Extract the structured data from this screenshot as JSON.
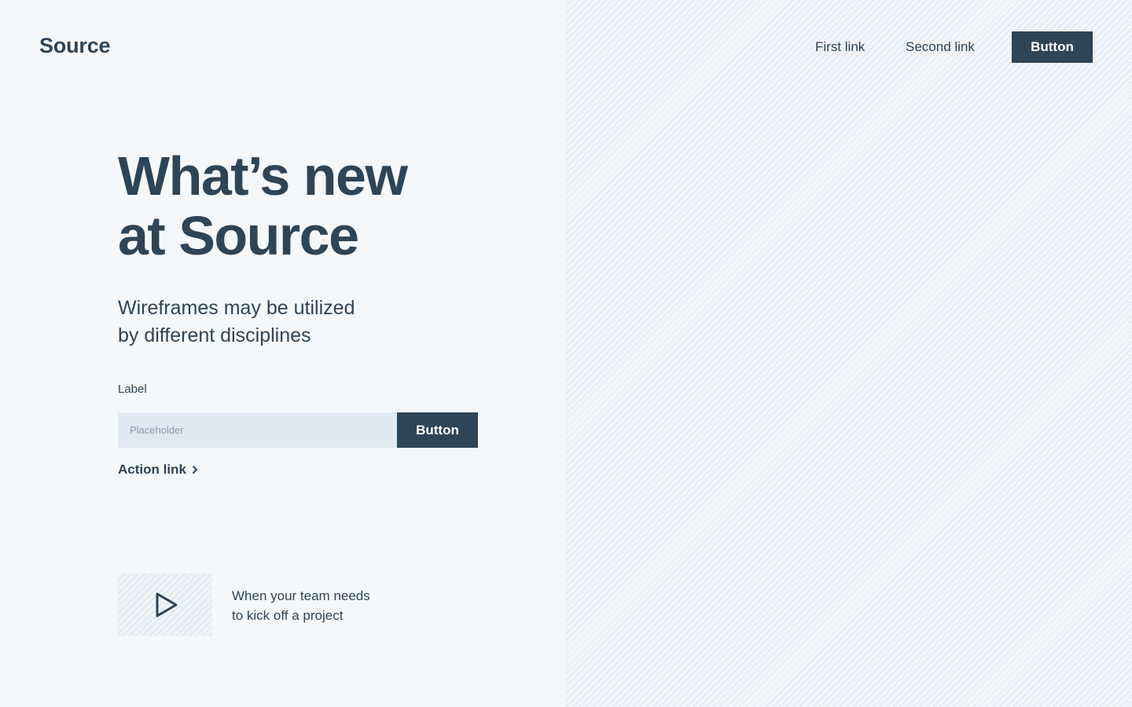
{
  "brand": {
    "logo_text": "Source"
  },
  "nav": {
    "links": [
      "First link",
      "Second link"
    ],
    "button_label": "Button"
  },
  "hero": {
    "headline_line1": "What’s new",
    "headline_line2": "at Source",
    "subhead_line1": "Wireframes may be utilized",
    "subhead_line2": "by different disciplines"
  },
  "form": {
    "label": "Label",
    "placeholder": "Placeholder",
    "value": "",
    "button_label": "Button",
    "action_link_label": "Action link"
  },
  "video": {
    "caption_line1": "When your team needs",
    "caption_line2": "to kick off a project"
  },
  "icons": {
    "play": "play-icon",
    "chevron": "chevron-right-icon"
  },
  "colors": {
    "primary": "#2e4457",
    "background": "#f4f8fb",
    "input_bg": "#e1e8ef"
  }
}
